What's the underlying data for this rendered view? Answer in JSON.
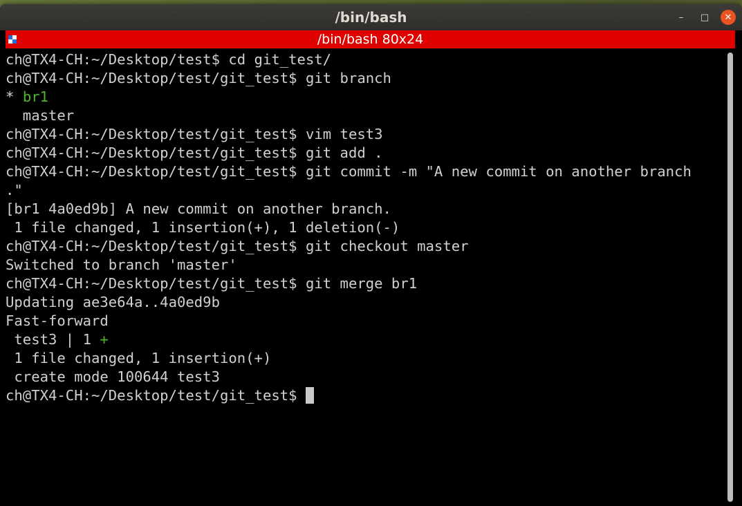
{
  "window": {
    "title": "/bin/bash",
    "minimize_glyph": "–",
    "maximize_glyph": "□",
    "close_glyph": "✕"
  },
  "tab": {
    "title": "/bin/bash 80x24",
    "icon": "terminal-tab-icon"
  },
  "colors": {
    "tab_bar": "#e00000",
    "titlebar": "#2f2e2b",
    "terminal_bg": "#000000",
    "terminal_fg": "#d0d0d0",
    "green": "#4eb627",
    "close_button": "#e95420"
  },
  "terminal": {
    "lines": [
      "ch@TX4-CH:~/Desktop/test$ cd git_test/",
      "ch@TX4-CH:~/Desktop/test/git_test$ git branch",
      {
        "prefix": "* ",
        "green": "br1"
      },
      "  master",
      "ch@TX4-CH:~/Desktop/test/git_test$ vim test3",
      "ch@TX4-CH:~/Desktop/test/git_test$ git add .",
      "ch@TX4-CH:~/Desktop/test/git_test$ git commit -m \"A new commit on another branch",
      ".\"",
      "[br1 4a0ed9b] A new commit on another branch.",
      " 1 file changed, 1 insertion(+), 1 deletion(-)",
      "ch@TX4-CH:~/Desktop/test/git_test$ git checkout master",
      "Switched to branch 'master'",
      "ch@TX4-CH:~/Desktop/test/git_test$ git merge br1",
      "Updating ae3e64a..4a0ed9b",
      "Fast-forward",
      {
        "prefix": " test3 | 1 ",
        "green": "+"
      },
      " 1 file changed, 1 insertion(+)",
      " create mode 100644 test3"
    ],
    "prompt": "ch@TX4-CH:~/Desktop/test/git_test$ "
  }
}
